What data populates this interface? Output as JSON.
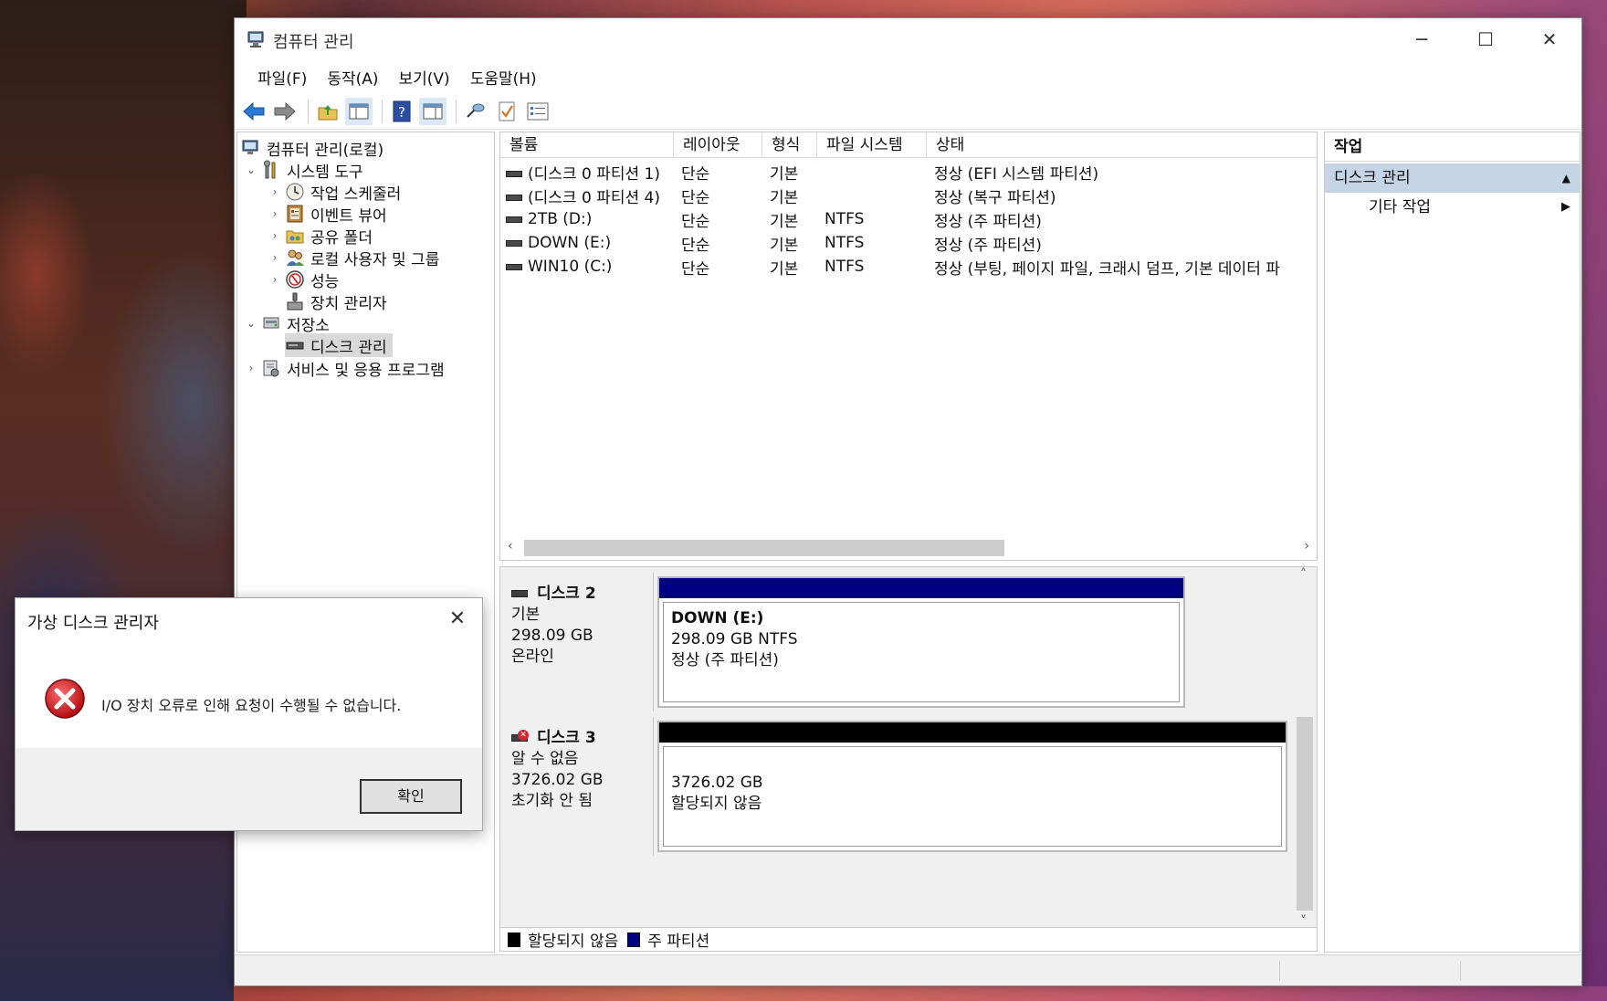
{
  "window": {
    "title": "컴퓨터 관리",
    "controls": {
      "minimize": "─",
      "maximize": "☐",
      "close": "✕"
    }
  },
  "menu": [
    "파일(F)",
    "동작(A)",
    "보기(V)",
    "도움말(H)"
  ],
  "toolbar": {
    "icons": [
      "back-arrow-icon",
      "forward-arrow-icon",
      "up-folder-icon",
      "show-hide-tree-icon",
      "help-icon",
      "show-hide-action-icon",
      "connect-icon",
      "check-icon",
      "properties-icon"
    ]
  },
  "tree": {
    "root": "컴퓨터 관리(로컬)",
    "system_tools": "시스템 도구",
    "task_scheduler": "작업 스케줄러",
    "event_viewer": "이벤트 뷰어",
    "shared_folders": "공유 폴더",
    "local_users": "로컬 사용자 및 그룹",
    "performance": "성능",
    "device_manager": "장치 관리자",
    "storage": "저장소",
    "disk_management": "디스크 관리",
    "services": "서비스 및 응용 프로그램"
  },
  "volume_list": {
    "columns": [
      "볼륨",
      "레이아웃",
      "형식",
      "파일 시스템",
      "상태"
    ],
    "rows": [
      {
        "volume": "(디스크 0 파티션 1)",
        "layout": "단순",
        "type": "기본",
        "fs": "",
        "status": "정상 (EFI 시스템 파티션)"
      },
      {
        "volume": "(디스크 0 파티션 4)",
        "layout": "단순",
        "type": "기본",
        "fs": "",
        "status": "정상 (복구 파티션)"
      },
      {
        "volume": "2TB (D:)",
        "layout": "단순",
        "type": "기본",
        "fs": "NTFS",
        "status": "정상 (주 파티션)"
      },
      {
        "volume": "DOWN (E:)",
        "layout": "단순",
        "type": "기본",
        "fs": "NTFS",
        "status": "정상 (주 파티션)"
      },
      {
        "volume": "WIN10 (C:)",
        "layout": "단순",
        "type": "기본",
        "fs": "NTFS",
        "status": "정상 (부팅, 페이지 파일, 크래시 덤프, 기본 데이터 파"
      }
    ]
  },
  "disks": [
    {
      "name": "디스크 2",
      "kind": "기본",
      "size": "298.09 GB",
      "state": "온라인",
      "partition_title": "DOWN  (E:)",
      "partition_line1": "298.09 GB NTFS",
      "partition_line2": "정상 (주 파티션)"
    },
    {
      "name": "디스크 3",
      "kind": "알 수 없음",
      "size": "3726.02 GB",
      "state": "초기화 안 됨",
      "partition_line1": "3726.02 GB",
      "partition_line2": "할당되지 않음"
    }
  ],
  "legend": {
    "unallocated": "할당되지 않음",
    "primary": "주 파티션"
  },
  "colors": {
    "primary_partition": "#000080",
    "unallocated": "#000000",
    "action_group_bg": "#c5d5e6"
  },
  "actions": {
    "title": "작업",
    "group": "디스크 관리",
    "more": "기타 작업"
  },
  "dialog": {
    "title": "가상 디스크 관리자",
    "message": "I/O 장치 오류로 인해 요청이 수행될 수 없습니다.",
    "ok": "확인",
    "close": "✕"
  }
}
